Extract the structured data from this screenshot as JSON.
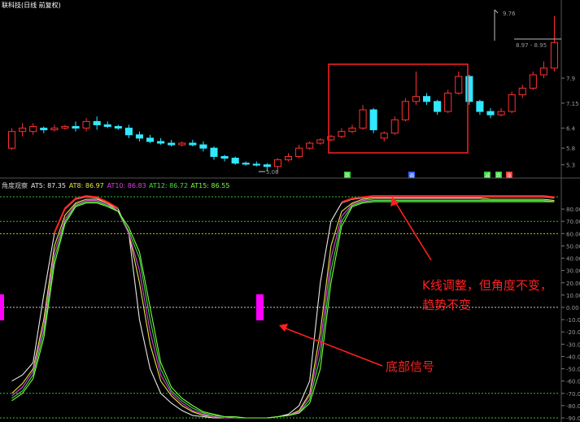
{
  "header": {
    "title": "联科技(日线 前复权)",
    "title_color": "#ffffff"
  },
  "price_panel": {
    "high_label": "9.76",
    "price_box_label": "8.97 - 8.95",
    "low_label": "5.06",
    "y_ticks": [
      "7.9",
      "7.15",
      "6.4",
      "5.8",
      "5.3"
    ],
    "signal_badges": [
      {
        "text": "跌",
        "color": "#30d030"
      },
      {
        "text": "调",
        "color": "#3060ff"
      },
      {
        "text": "减",
        "color": "#30d030"
      },
      {
        "text": "跌",
        "color": "#30d030"
      },
      {
        "text": "涨",
        "color": "#ff3030"
      }
    ]
  },
  "indicator_panel": {
    "name": "角度观察",
    "lines": [
      {
        "label": "AT5",
        "value": "87.35",
        "color": "#e8e8e8"
      },
      {
        "label": "AT8",
        "value": "86.97",
        "color": "#e8e848"
      },
      {
        "label": "AT10",
        "value": "86.83",
        "color": "#e040e0"
      },
      {
        "label": "AT12",
        "value": "86.72",
        "color": "#40e040"
      },
      {
        "label": "AT15",
        "value": "86.55",
        "color": "#80ff40"
      }
    ],
    "y_ticks": [
      "80.00",
      "70.00",
      "60.00",
      "50.00",
      "40.00",
      "30.00",
      "20.00",
      "10.00",
      "0.00",
      "-10.00",
      "-20.00",
      "-30.00",
      "-40.00",
      "-50.00",
      "-60.00",
      "-70.00",
      "-80.00",
      "-90.00"
    ]
  },
  "annotations": {
    "top_right": [
      "K线调整，但角度不变，",
      "趋势不变"
    ],
    "bottom": "底部信号"
  },
  "colors": {
    "up": "#ff3030",
    "down": "#30e8ff",
    "signal_bar": "#ff00ff",
    "annotation": "#ff2020",
    "grid_green": "#30c030",
    "grid_yellow": "#c8c800"
  },
  "chart_data": [
    {
      "type": "candlestick",
      "title": "联科技(日线 前复权)",
      "y_range": [
        5.0,
        10.0
      ],
      "candles": [
        [
          5.8,
          6.3,
          6.4,
          5.75
        ],
        [
          6.3,
          6.4,
          6.55,
          6.15
        ],
        [
          6.3,
          6.45,
          6.55,
          6.2
        ],
        [
          6.4,
          6.35,
          6.45,
          6.25
        ],
        [
          6.35,
          6.4,
          6.5,
          6.3
        ],
        [
          6.4,
          6.45,
          6.5,
          6.35
        ],
        [
          6.45,
          6.4,
          6.6,
          6.3
        ],
        [
          6.4,
          6.6,
          6.7,
          6.3
        ],
        [
          6.6,
          6.5,
          6.75,
          6.35
        ],
        [
          6.5,
          6.45,
          6.6,
          6.4
        ],
        [
          6.45,
          6.4,
          6.5,
          6.35
        ],
        [
          6.4,
          6.2,
          6.5,
          6.1
        ],
        [
          6.2,
          6.1,
          6.3,
          6.0
        ],
        [
          6.1,
          6.0,
          6.2,
          5.95
        ],
        [
          6.0,
          5.95,
          6.1,
          5.9
        ],
        [
          5.95,
          5.9,
          6.05,
          5.85
        ],
        [
          5.9,
          5.95,
          6.0,
          5.85
        ],
        [
          5.95,
          5.9,
          6.05,
          5.85
        ],
        [
          5.9,
          5.8,
          6.0,
          5.7
        ],
        [
          5.8,
          5.55,
          5.85,
          5.45
        ],
        [
          5.55,
          5.5,
          5.6,
          5.4
        ],
        [
          5.5,
          5.35,
          5.55,
          5.3
        ],
        [
          5.35,
          5.32,
          5.4,
          5.28
        ],
        [
          5.32,
          5.3,
          5.4,
          5.25
        ],
        [
          5.3,
          5.25,
          5.35,
          5.1
        ],
        [
          5.25,
          5.45,
          5.5,
          5.06
        ],
        [
          5.45,
          5.55,
          5.65,
          5.4
        ],
        [
          5.55,
          5.8,
          5.9,
          5.5
        ],
        [
          5.8,
          5.95,
          6.0,
          5.75
        ],
        [
          5.95,
          6.05,
          6.1,
          5.9
        ],
        [
          6.05,
          6.15,
          6.2,
          6.0
        ],
        [
          6.15,
          6.3,
          6.4,
          6.1
        ],
        [
          6.3,
          6.4,
          6.5,
          6.25
        ],
        [
          6.4,
          6.95,
          7.1,
          6.35
        ],
        [
          6.95,
          6.35,
          7.0,
          6.25
        ],
        [
          6.1,
          6.25,
          6.3,
          6.0
        ],
        [
          6.25,
          6.65,
          6.75,
          6.2
        ],
        [
          6.65,
          7.2,
          7.3,
          6.6
        ],
        [
          7.2,
          7.35,
          8.1,
          7.1
        ],
        [
          7.35,
          7.2,
          7.45,
          7.1
        ],
        [
          7.2,
          6.9,
          7.25,
          6.8
        ],
        [
          6.9,
          7.45,
          7.55,
          6.85
        ],
        [
          7.45,
          7.95,
          8.1,
          7.4
        ],
        [
          7.95,
          7.2,
          8.0,
          7.1
        ],
        [
          7.2,
          6.9,
          7.25,
          6.8
        ],
        [
          6.9,
          6.8,
          7.0,
          6.7
        ],
        [
          6.8,
          6.9,
          7.0,
          6.75
        ],
        [
          6.9,
          7.4,
          7.5,
          6.85
        ],
        [
          7.4,
          7.6,
          7.7,
          7.3
        ],
        [
          7.6,
          8.0,
          8.1,
          7.55
        ],
        [
          8.0,
          8.2,
          8.4,
          7.9
        ],
        [
          8.2,
          8.97,
          9.76,
          8.1
        ]
      ]
    },
    {
      "type": "line",
      "title": "角度观察",
      "ylim": [
        -90,
        90
      ],
      "series": [
        {
          "name": "AT5",
          "values": [
            -60,
            -55,
            -45,
            10,
            60,
            80,
            88,
            90,
            89,
            85,
            80,
            60,
            -10,
            -50,
            -70,
            -78,
            -84,
            -88,
            -89,
            -90,
            -90,
            -90,
            -90,
            -90,
            -90,
            -89,
            -87,
            -80,
            -60,
            20,
            70,
            85,
            88,
            89,
            90,
            90,
            90,
            90,
            90,
            90,
            90,
            90,
            90,
            90,
            90,
            90,
            90,
            90,
            90,
            90,
            90,
            89
          ]
        },
        {
          "name": "AT8",
          "values": [
            -70,
            -62,
            -50,
            -10,
            50,
            75,
            85,
            88,
            88,
            85,
            78,
            60,
            20,
            -30,
            -60,
            -72,
            -80,
            -85,
            -88,
            -89,
            -90,
            -90,
            -90,
            -90,
            -90,
            -89,
            -88,
            -84,
            -70,
            -20,
            50,
            78,
            85,
            88,
            89,
            89,
            89,
            89,
            89,
            89,
            89,
            89,
            89,
            89,
            89,
            88,
            88,
            88,
            88,
            88,
            88,
            87
          ]
        },
        {
          "name": "AT10",
          "values": [
            -72,
            -65,
            -52,
            -15,
            45,
            72,
            84,
            87,
            87,
            84,
            78,
            60,
            30,
            -20,
            -55,
            -70,
            -78,
            -84,
            -87,
            -89,
            -90,
            -90,
            -90,
            -90,
            -90,
            -89,
            -88,
            -85,
            -72,
            -30,
            40,
            74,
            84,
            87,
            88,
            88,
            88,
            88,
            88,
            88,
            88,
            88,
            88,
            88,
            88,
            87,
            87,
            87,
            87,
            87,
            87,
            86
          ]
        },
        {
          "name": "AT12",
          "values": [
            -74,
            -68,
            -55,
            -20,
            40,
            70,
            83,
            86,
            86,
            83,
            78,
            62,
            40,
            -10,
            -50,
            -68,
            -76,
            -82,
            -86,
            -88,
            -89,
            -90,
            -90,
            -90,
            -90,
            -89,
            -88,
            -86,
            -75,
            -40,
            30,
            70,
            83,
            86,
            87,
            87,
            87,
            87,
            87,
            87,
            87,
            87,
            87,
            87,
            87,
            87,
            87,
            87,
            87,
            87,
            87,
            86
          ]
        },
        {
          "name": "AT15",
          "values": [
            -76,
            -70,
            -58,
            -25,
            35,
            68,
            82,
            85,
            85,
            82,
            78,
            65,
            45,
            0,
            -45,
            -65,
            -74,
            -80,
            -85,
            -87,
            -89,
            -89,
            -90,
            -90,
            -90,
            -89,
            -88,
            -86,
            -78,
            -50,
            20,
            66,
            82,
            85,
            86,
            86,
            86,
            86,
            86,
            86,
            86,
            86,
            86,
            86,
            86,
            86,
            86,
            86,
            86,
            86,
            86,
            86
          ]
        }
      ]
    }
  ]
}
